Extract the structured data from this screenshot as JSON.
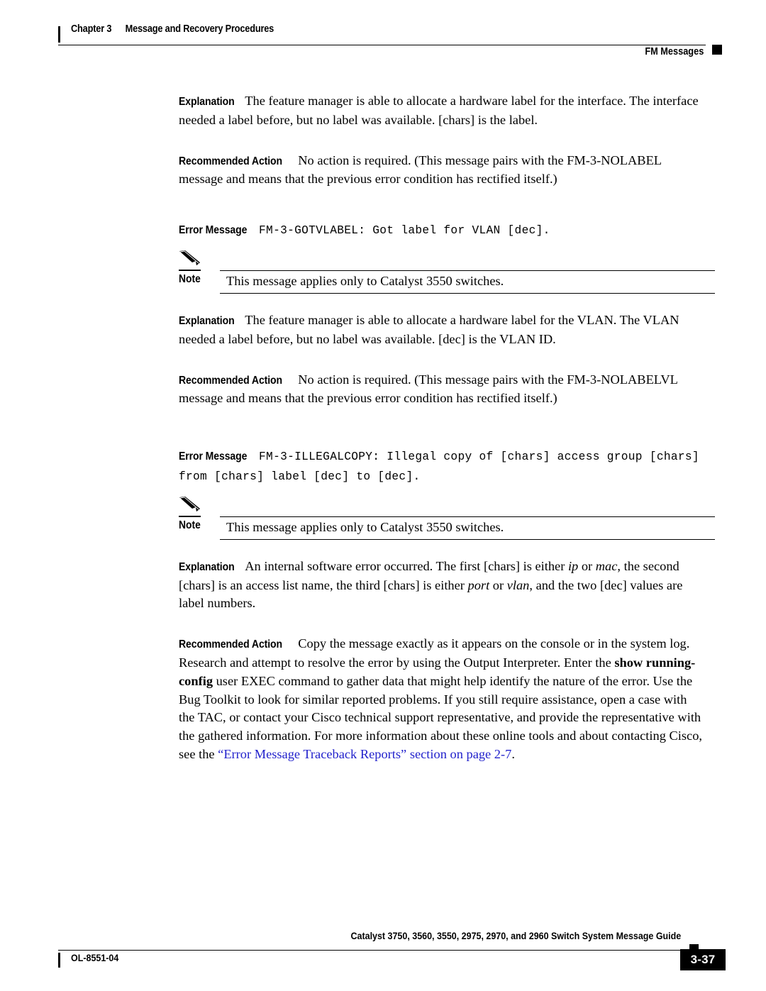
{
  "header": {
    "chapter": "Chapter 3",
    "chapter_title": "Message and Recovery Procedures",
    "section": "FM Messages"
  },
  "content": {
    "block1": {
      "explanation_label": "Explanation",
      "explanation_text": "The feature manager is able to allocate a hardware label for the interface. The interface needed a label before, but no label was available. [chars] is the label.",
      "action_label": "Recommended Action",
      "action_text": "No action is required. (This message pairs with the FM-3-NOLABEL message and means that the previous error condition has rectified itself.)"
    },
    "block2": {
      "error_label": "Error Message",
      "error_code": "FM-3-GOTVLABEL: Got label for VLAN [dec].",
      "note_label": "Note",
      "note_text": "This message applies only to Catalyst 3550 switches.",
      "explanation_label": "Explanation",
      "explanation_text": "The feature manager is able to allocate a hardware label for the VLAN. The VLAN needed a label before, but no label was available. [dec] is the VLAN ID.",
      "action_label": "Recommended Action",
      "action_text": "No action is required. (This message pairs with the FM-3-NOLABELVL message and means that the previous error condition has rectified itself.)"
    },
    "block3": {
      "error_label": "Error Message",
      "error_code": "FM-3-ILLEGALCOPY: Illegal copy of [chars] access group [chars] from [chars] label [dec] to [dec].",
      "note_label": "Note",
      "note_text": "This message applies only to Catalyst 3550 switches.",
      "explanation_label": "Explanation",
      "explanation_text_1": "An internal software error occurred. The first [chars] is either ",
      "explanation_em_1": "ip",
      "explanation_text_2": " or ",
      "explanation_em_2": "mac",
      "explanation_text_3": ", the second [chars] is an access list name, the third [chars] is either ",
      "explanation_em_3": "port",
      "explanation_text_4": " or ",
      "explanation_em_4": "vlan",
      "explanation_text_5": ", and the two [dec] values are label numbers.",
      "action_label": "Recommended Action",
      "action_text_1": "Copy the message exactly as it appears on the console or in the system log. Research and attempt to resolve the error by using the Output Interpreter. Enter the ",
      "action_cmd_1": "show running-config",
      "action_text_2": " user EXEC command to gather data that might help identify the nature of the error. Use the Bug Toolkit to look for similar reported problems. If you still require assistance, open a case with the TAC, or contact your Cisco technical support representative, and provide the representative with the gathered information. For more information about these online tools and about contacting Cisco, see the ",
      "action_xref": "“Error Message Traceback Reports” section on page 2-7",
      "action_text_3": "."
    }
  },
  "footer": {
    "title": "Catalyst 3750, 3560, 3550, 2975, 2970, and 2960 Switch System Message Guide",
    "doc_id": "OL-8551-04",
    "page_number": "3-37"
  },
  "colors": {
    "xref_blue": "#2222cc",
    "text_black": "#000000",
    "page_background": "#ffffff"
  }
}
